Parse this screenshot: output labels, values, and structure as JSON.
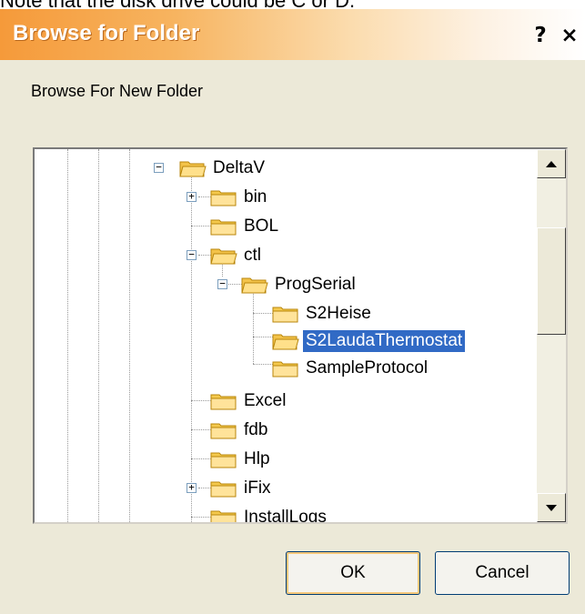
{
  "caption": "Note that the disk drive could be C or D.",
  "dialog": {
    "title": "Browse for Folder",
    "help_label": "?",
    "close_label": "×",
    "instruction": "Browse For New Folder",
    "ok_label": "OK",
    "cancel_label": "Cancel"
  },
  "tree": {
    "items": [
      {
        "label": "DeltaV",
        "expander": "−",
        "icon": "folder-open-icon"
      },
      {
        "label": "bin",
        "expander": "+",
        "icon": "folder-icon"
      },
      {
        "label": "BOL",
        "expander": "",
        "icon": "folder-icon"
      },
      {
        "label": "ctl",
        "expander": "−",
        "icon": "folder-open-icon"
      },
      {
        "label": "ProgSerial",
        "expander": "−",
        "icon": "folder-open-icon"
      },
      {
        "label": "S2Heise",
        "expander": "",
        "icon": "folder-icon"
      },
      {
        "label": "S2LaudaThermostat",
        "expander": "",
        "icon": "folder-open-icon",
        "selected": true
      },
      {
        "label": "SampleProtocol",
        "expander": "",
        "icon": "folder-icon"
      },
      {
        "label": "Excel",
        "expander": "",
        "icon": "folder-icon"
      },
      {
        "label": "fdb",
        "expander": "",
        "icon": "folder-icon"
      },
      {
        "label": "Hlp",
        "expander": "",
        "icon": "folder-icon"
      },
      {
        "label": "iFix",
        "expander": "+",
        "icon": "folder-icon"
      },
      {
        "label": "InstallLogs",
        "expander": "",
        "icon": "folder-icon"
      }
    ]
  },
  "colors": {
    "title_gradient_start": "#f59a3a",
    "selection": "#316ac5",
    "dialog_bg": "#ece9d8"
  }
}
